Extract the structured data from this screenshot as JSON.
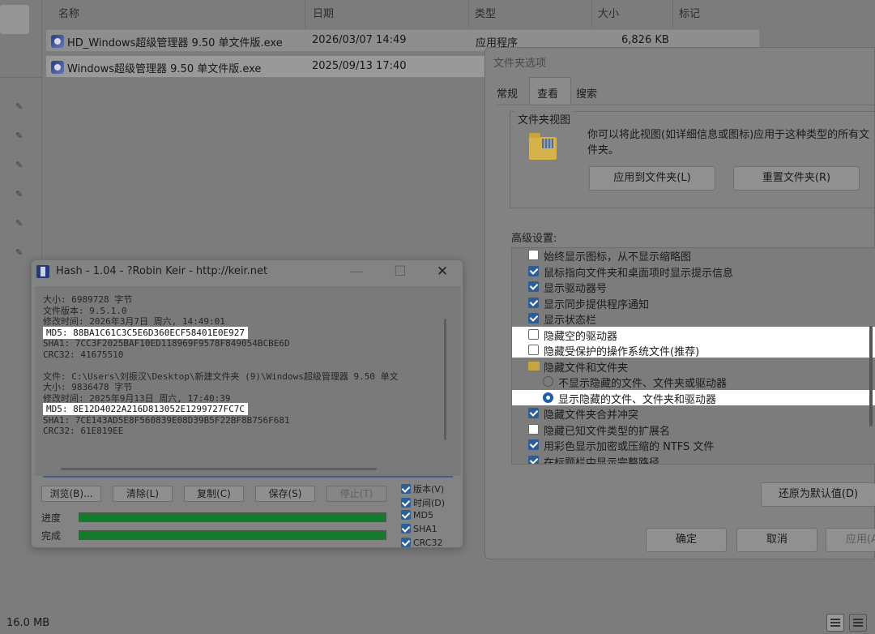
{
  "explorer": {
    "columns": {
      "name": "名称",
      "date": "日期",
      "type": "类型",
      "size": "大小",
      "tags": "标记"
    },
    "files": [
      {
        "name": "HD_Windows超级管理器 9.50 单文件版.exe",
        "date": "2026/03/07 14:49",
        "type": "应用程序",
        "size": "6,826 KB"
      },
      {
        "name": "Windows超级管理器 9.50 单文件版.exe",
        "date": "2025/09/13 17:40",
        "type": "",
        "size": ""
      }
    ],
    "status_size": "16.0 MB"
  },
  "hash": {
    "title": "Hash - 1.04 - ?Robin Keir - http://keir.net",
    "controls": {
      "minimize": "—",
      "maximize": "☐",
      "close": "✕"
    },
    "lines": [
      {
        "text": "大小: 6989728 字节",
        "highlight": false
      },
      {
        "text": "文件版本: 9.5.1.0",
        "highlight": false
      },
      {
        "text": "修改时间: 2026年3月7日 周六, 14:49:01",
        "highlight": false
      },
      {
        "text": "MD5: 88BA1C61C3C5E6D360ECF58401E0E927",
        "highlight": true
      },
      {
        "text": "SHA1: 7CC3F2025BAF10ED118969F9578F849054BCBE6D",
        "highlight": false
      },
      {
        "text": "CRC32: 41675510",
        "highlight": false
      },
      {
        "text": "",
        "highlight": false
      },
      {
        "text": "文件: C:\\Users\\刘振汉\\Desktop\\新建文件夹 (9)\\Windows超级管理器 9.50 单文",
        "highlight": false
      },
      {
        "text": "大小: 9836478 字节",
        "highlight": false
      },
      {
        "text": "修改时间: 2025年9月13日 周六, 17:40:39",
        "highlight": false
      },
      {
        "text": "MD5: 8E12D4022A216D813052E1299727FC7C",
        "highlight": true
      },
      {
        "text": "SHA1: 7CE143AD5E8F560839E08D39B5F22BF8B756F681",
        "highlight": false
      },
      {
        "text": "CRC32: 61E819EE",
        "highlight": false
      }
    ],
    "buttons": {
      "browse": "浏览(B)...",
      "clear": "清除(L)",
      "copy": "复制(C)",
      "save": "保存(S)",
      "stop": "停止(T)"
    },
    "progress_label": "进度",
    "complete_label": "完成",
    "progress": 1.0,
    "complete": 1.0,
    "options": [
      {
        "label": "版本(V)",
        "checked": true
      },
      {
        "label": "时间(D)",
        "checked": true
      },
      {
        "label": "MD5",
        "checked": true
      },
      {
        "label": "SHA1",
        "checked": true
      },
      {
        "label": "CRC32",
        "checked": true
      }
    ]
  },
  "folder_options": {
    "title": "文件夹选项",
    "tabs": [
      "常规",
      "查看",
      "搜索"
    ],
    "active_tab": "查看",
    "folder_view_title": "文件夹视图",
    "folder_view_desc": "你可以将此视图(如详细信息或图标)应用于这种类型的所有文件夹。",
    "apply_button": "应用到文件夹(L)",
    "reset_button": "重置文件夹(R)",
    "advanced_label": "高级设置:",
    "advanced_items": [
      {
        "type": "checkbox",
        "checked": false,
        "label": "始终显示图标，从不显示缩略图",
        "indent": 0,
        "highlight": false
      },
      {
        "type": "checkbox",
        "checked": true,
        "label": "鼠标指向文件夹和桌面项时显示提示信息",
        "indent": 0,
        "highlight": false
      },
      {
        "type": "checkbox",
        "checked": true,
        "label": "显示驱动器号",
        "indent": 0,
        "highlight": false
      },
      {
        "type": "checkbox",
        "checked": true,
        "label": "显示同步提供程序通知",
        "indent": 0,
        "highlight": false
      },
      {
        "type": "checkbox",
        "checked": true,
        "label": "显示状态栏",
        "indent": 0,
        "highlight": false
      },
      {
        "type": "checkbox",
        "checked": false,
        "label": "隐藏空的驱动器",
        "indent": 0,
        "highlight": true
      },
      {
        "type": "checkbox",
        "checked": false,
        "label": "隐藏受保护的操作系统文件(推荐)",
        "indent": 0,
        "highlight": true
      },
      {
        "type": "folder",
        "checked": false,
        "label": "隐藏文件和文件夹",
        "indent": 0,
        "highlight": false
      },
      {
        "type": "radio",
        "checked": false,
        "label": "不显示隐藏的文件、文件夹或驱动器",
        "indent": 1,
        "highlight": false
      },
      {
        "type": "radio",
        "checked": true,
        "label": "显示隐藏的文件、文件夹和驱动器",
        "indent": 1,
        "highlight": true
      },
      {
        "type": "checkbox",
        "checked": true,
        "label": "隐藏文件夹合并冲突",
        "indent": 0,
        "highlight": false
      },
      {
        "type": "checkbox",
        "checked": false,
        "label": "隐藏已知文件类型的扩展名",
        "indent": 0,
        "highlight": false
      },
      {
        "type": "checkbox",
        "checked": true,
        "label": "用彩色显示加密或压缩的 NTFS 文件",
        "indent": 0,
        "highlight": false
      },
      {
        "type": "checkbox",
        "checked": true,
        "label": "在标题栏中显示完整路径",
        "indent": 0,
        "highlight": false
      }
    ],
    "restore_button": "还原为默认值(D)",
    "ok_button": "确定",
    "cancel_button": "取消",
    "apply_bottom_button": "应用(A)"
  }
}
